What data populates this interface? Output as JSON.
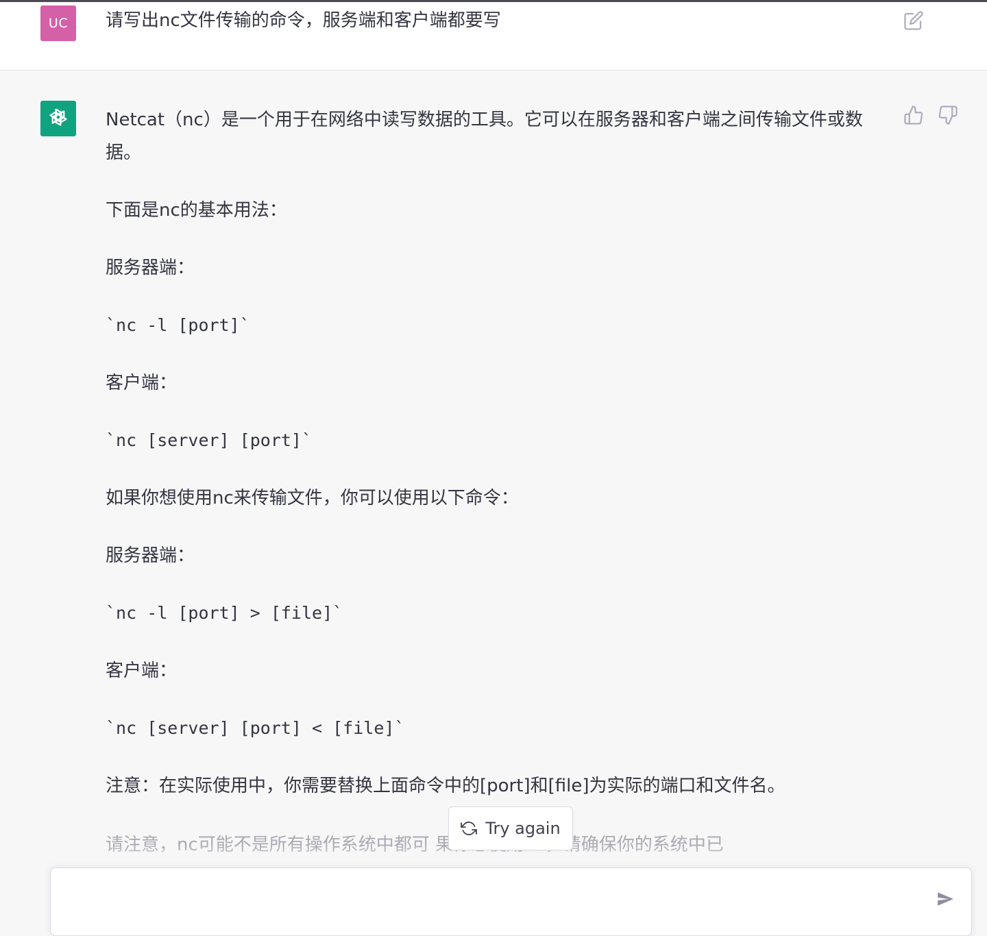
{
  "user_message": {
    "avatar_initials": "UC",
    "avatar_color": "#d460a8",
    "text": "请写出nc文件传输的命令，服务端和客户端都要写",
    "edit_icon": "edit-icon"
  },
  "assistant_message": {
    "avatar_color": "#10a37f",
    "avatar_icon": "openai-logo-icon",
    "feedback_icons": [
      "thumbs-up-icon",
      "thumbs-down-icon"
    ],
    "paragraphs": [
      {
        "type": "text",
        "text": "Netcat（nc）是一个用于在网络中读写数据的工具。它可以在服务器和客户端之间传输文件或数据。"
      },
      {
        "type": "text",
        "text": "下面是nc的基本用法："
      },
      {
        "type": "text",
        "text": "服务器端："
      },
      {
        "type": "code",
        "text": "`nc -l [port]`"
      },
      {
        "type": "text",
        "text": "客户端："
      },
      {
        "type": "code",
        "text": "`nc [server] [port]`"
      },
      {
        "type": "text",
        "text": "如果你想使用nc来传输文件，你可以使用以下命令："
      },
      {
        "type": "text",
        "text": "服务器端："
      },
      {
        "type": "code",
        "text": "`nc -l [port] > [file]`"
      },
      {
        "type": "text",
        "text": "客户端："
      },
      {
        "type": "code",
        "text": "`nc [server] [port] < [file]`"
      },
      {
        "type": "text",
        "text": "注意：在实际使用中，你需要替换上面命令中的[port]和[file]为实际的端口和文件名。"
      }
    ],
    "truncated_paragraph": "请注意，nc可能不是所有操作系统中都可                果你想使用nc，请确保你的系统中已"
  },
  "try_again": {
    "label": "Try again",
    "icon": "refresh-icon"
  },
  "composer": {
    "value": "",
    "placeholder": "",
    "send_icon": "send-icon"
  },
  "colors": {
    "background": "#f7f7f8",
    "user_row_bg": "#ffffff",
    "text": "#343541",
    "faded_text": "#aaaab3"
  }
}
